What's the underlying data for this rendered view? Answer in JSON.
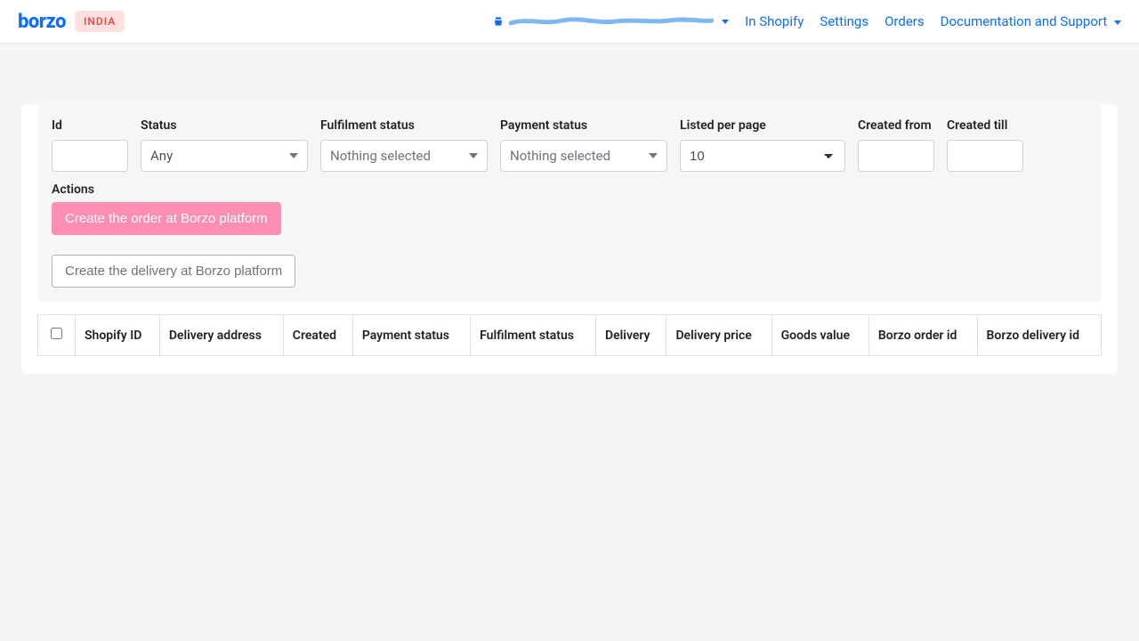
{
  "header": {
    "logo": "borzo",
    "country": "INDIA",
    "nav": {
      "in_shopify": "In Shopify",
      "settings": "Settings",
      "orders": "Orders",
      "docs": "Documentation and Support"
    }
  },
  "filters": {
    "id_label": "Id",
    "status_label": "Status",
    "status_value": "Any",
    "fulfilment_label": "Fulfilment status",
    "fulfilment_value": "Nothing selected",
    "payment_label": "Payment status",
    "payment_value": "Nothing selected",
    "listed_label": "Listed per page",
    "listed_value": "10",
    "created_from_label": "Created from",
    "created_till_label": "Created till",
    "actions_label": "Actions",
    "create_order_btn": "Create the order at Borzo platform",
    "create_delivery_btn": "Create the delivery at Borzo platform"
  },
  "table": {
    "columns": {
      "shopify_id": "Shopify ID",
      "delivery_address": "Delivery address",
      "created": "Created",
      "payment_status": "Payment status",
      "fulfilment_status": "Fulfilment status",
      "delivery": "Delivery",
      "delivery_price": "Delivery price",
      "goods_value": "Goods value",
      "borzo_order_id": "Borzo order id",
      "borzo_delivery_id": "Borzo delivery id"
    }
  }
}
